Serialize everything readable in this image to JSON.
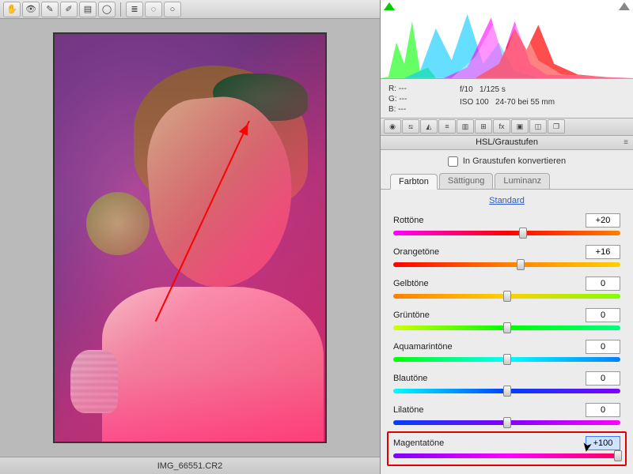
{
  "toolbar_icons": [
    "hand",
    "eye-plus",
    "brush",
    "brush-alt",
    "gradient",
    "circle",
    "list",
    "ellipse-dash",
    "ellipse"
  ],
  "filename": "IMG_66551.CR2",
  "info": {
    "r": "R:   ---",
    "g": "G:   ---",
    "b": "B:   ---",
    "aperture": "f/10",
    "shutter": "1/125 s",
    "iso": "ISO 100",
    "lens": "24-70 bei 55 mm"
  },
  "icon_strip": [
    "aperture",
    "curve",
    "prism",
    "crop",
    "split",
    "tone",
    "fx",
    "camera",
    "lens",
    "stack"
  ],
  "panel_title": "HSL/Graustufen",
  "convert_label": "In Graustufen konvertieren",
  "tabs": {
    "hue": "Farbton",
    "sat": "Sättigung",
    "lum": "Luminanz"
  },
  "default_link": "Standard",
  "sliders": [
    {
      "label": "Rottöne",
      "value": "+20",
      "pos": 57,
      "grad": "g-red"
    },
    {
      "label": "Orangetöne",
      "value": "+16",
      "pos": 56,
      "grad": "g-orange"
    },
    {
      "label": "Gelbtöne",
      "value": "0",
      "pos": 50,
      "grad": "g-yellow"
    },
    {
      "label": "Grüntöne",
      "value": "0",
      "pos": 50,
      "grad": "g-green"
    },
    {
      "label": "Aquamarintöne",
      "value": "0",
      "pos": 50,
      "grad": "g-aqua"
    },
    {
      "label": "Blautöne",
      "value": "0",
      "pos": 50,
      "grad": "g-blue"
    },
    {
      "label": "Lilatöne",
      "value": "0",
      "pos": 50,
      "grad": "g-purple"
    },
    {
      "label": "Magentatöne",
      "value": "+100",
      "pos": 99,
      "grad": "g-magenta"
    }
  ]
}
